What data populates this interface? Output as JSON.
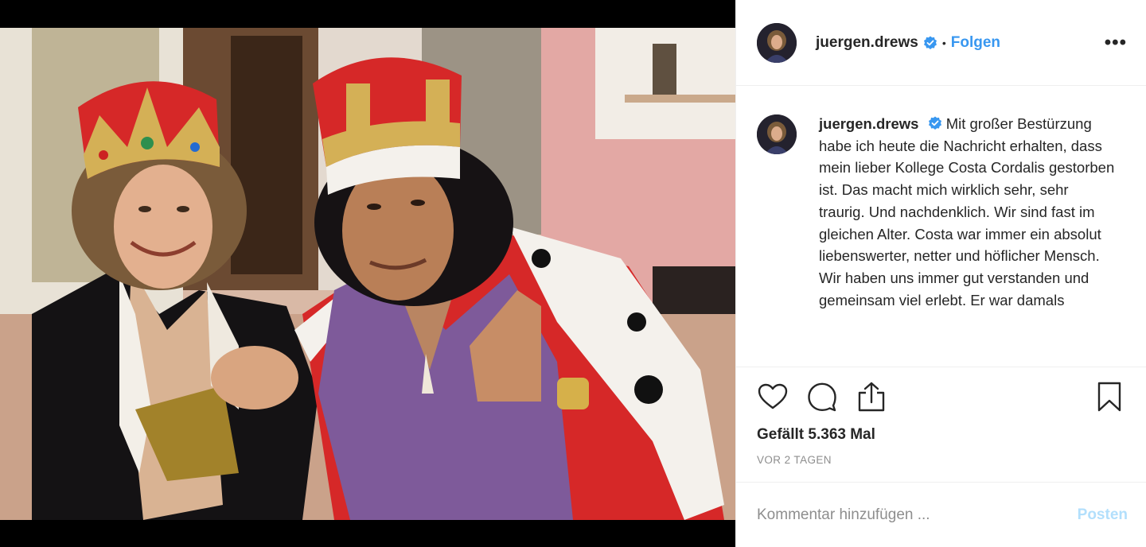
{
  "post": {
    "username": "juergen.drews",
    "separator": "•",
    "follow_label": "Folgen",
    "more_label": "•••",
    "caption_text": "Mit großer Bestürzung habe ich heute die Nachricht erhalten, dass mein lieber Kollege Costa Cordalis gestorben ist. Das macht mich wirklich sehr, sehr traurig. Und nachdenklich. Wir sind fast im gleichen Alter. Costa war immer ein absolut liebenswerter, netter und höflicher Mensch. Wir haben uns immer gut verstanden und gemeinsam viel erlebt. Er war damals",
    "likes_text": "Gefällt 5.363 Mal",
    "time_text": "VOR 2 TAGEN",
    "comment_placeholder": "Kommentar hinzufügen ...",
    "post_label": "Posten"
  },
  "icons": {
    "verified": "verified-badge-icon",
    "like": "heart-icon",
    "comment": "comment-bubble-icon",
    "share": "share-icon",
    "save": "bookmark-icon",
    "more": "more-dots-icon"
  },
  "colors": {
    "accent": "#3897f0",
    "post_disabled": "#b2dffc",
    "muted": "#8e8e8e",
    "text": "#262626",
    "border": "#efefef"
  }
}
